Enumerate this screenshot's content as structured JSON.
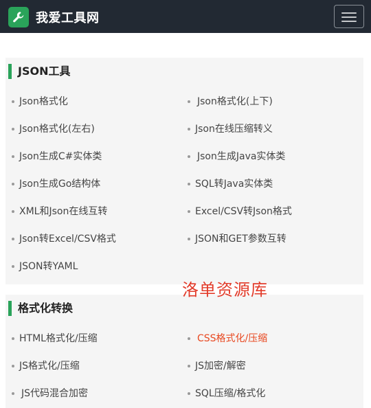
{
  "header": {
    "brand_name": "我爱工具网",
    "brand_icon": "wrench-icon",
    "menu_icon": "hamburger-menu-icon"
  },
  "sections": [
    {
      "title": "JSON工具",
      "items": [
        "Json格式化",
        "Json格式化(上下)",
        "Json格式化(左右)",
        "Json在线压缩转义",
        "Json生成C#实体类",
        "Json生成Java实体类",
        "Json生成Go结构体",
        "SQL转Java实体类",
        "XML和Json在线互转",
        "Excel/CSV转Json格式",
        "Json转Excel/CSV格式",
        "JSON和GET参数互转",
        "JSON转YAML"
      ]
    },
    {
      "title": "格式化转换",
      "items": [
        "HTML格式化/压缩",
        "CSS格式化/压缩",
        "JS格式化/压缩",
        "JS加密/解密",
        "JS代码混合加密",
        "SQL压缩/格式化"
      ]
    }
  ],
  "watermark": "洛单资源库",
  "colors": {
    "navbar_bg": "#222933",
    "brand_green": "#2aa35a",
    "active_link": "#e8471f",
    "watermark": "#e23b2a"
  }
}
